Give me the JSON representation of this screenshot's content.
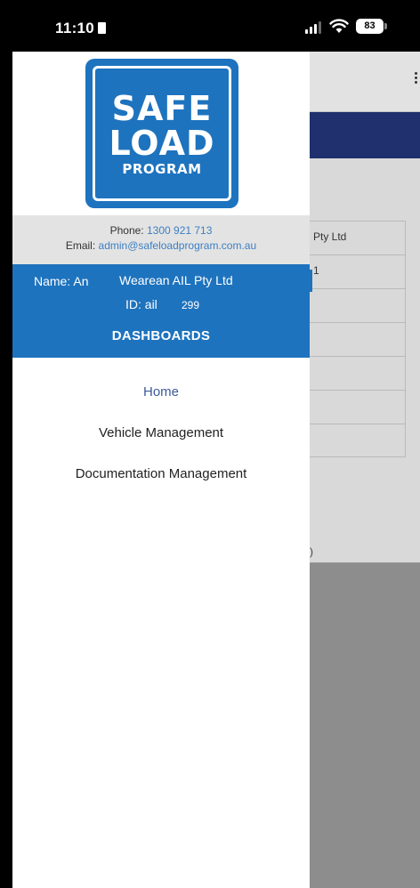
{
  "status_bar": {
    "time": "11:10",
    "battery": "83"
  },
  "drawer": {
    "logo": {
      "line1": "SAFE",
      "line2": "LOAD",
      "line3": "PROGRAM"
    },
    "contact": {
      "phone_label": "Phone:",
      "phone": "1300 921 713",
      "email_label": "Email:",
      "email": "admin@safeloadprogram.com.au"
    },
    "user": {
      "name_label": "Name: An",
      "company": "Wearean AIL Pty Ltd",
      "id_label": "ID: ail",
      "id_value": "299"
    },
    "section_title": "DASHBOARDS",
    "nav_items": [
      {
        "label": "Home",
        "active": true
      },
      {
        "label": "Vehicle Management",
        "active": false
      },
      {
        "label": "Documentation Management",
        "active": false
      }
    ]
  },
  "background_app": {
    "rows": [
      "Pty Ltd",
      "1",
      "",
      "",
      "",
      "",
      ""
    ],
    "footer_fragment": ")"
  },
  "colors": {
    "brand_blue": "#1e73be",
    "link_blue": "#3d7fc4",
    "active_nav": "#3d5a9a",
    "banner_navy": "#20306e"
  }
}
